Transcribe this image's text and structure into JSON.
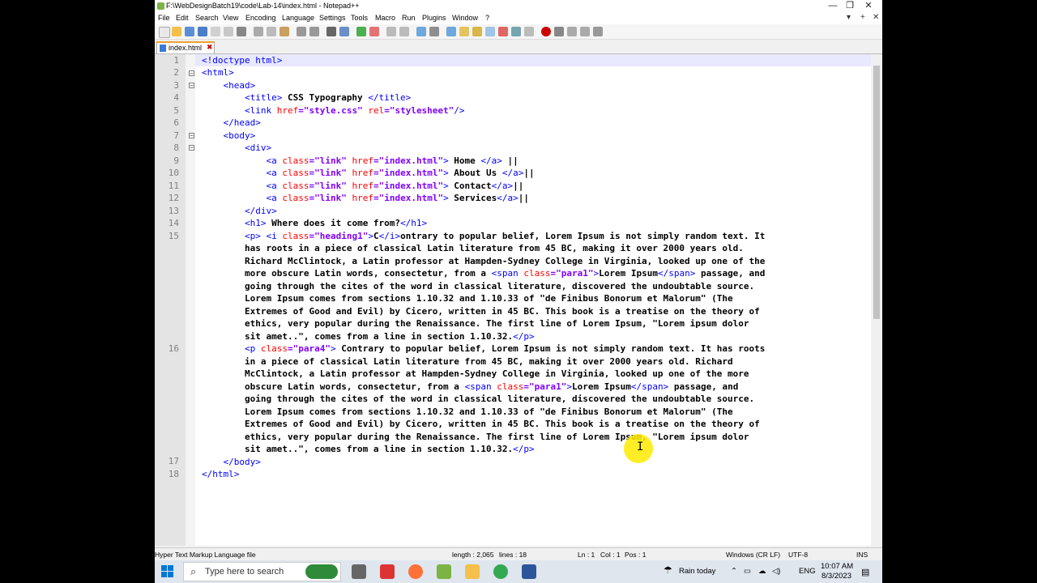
{
  "window": {
    "title": "F:\\WebDesignBatch19\\code\\Lab-14\\index.html - Notepad++",
    "min_icon": "minimize-icon",
    "max_icon": "restore-icon",
    "close_icon": "close-icon",
    "min_glyph": "—",
    "max_glyph": "❐",
    "close_glyph": "✕"
  },
  "menu": {
    "items": [
      "File",
      "Edit",
      "Search",
      "View",
      "Encoding",
      "Language",
      "Settings",
      "Tools",
      "Macro",
      "Run",
      "Plugins",
      "Window",
      "?"
    ],
    "right_glyphs": [
      "▾",
      "+",
      "✕"
    ]
  },
  "tab": {
    "label": "index.html",
    "close_glyph": "✖"
  },
  "editor": {
    "line_numbers": [
      "1",
      "2",
      "3",
      "4",
      "5",
      "6",
      "7",
      "8",
      "9",
      "10",
      "11",
      "12",
      "13",
      "14",
      "15",
      "16",
      "17",
      "18"
    ]
  },
  "code": {
    "l1": "<!doctype html>",
    "l2": "<html>",
    "l3": "<head>",
    "l4a": "<title>",
    "l4b": " CSS Typography ",
    "l4c": "</title>",
    "l5a": "<link ",
    "l5b": "href",
    "l5c": "=\"style.css\" ",
    "l5d": "rel",
    "l5e": "=\"stylesheet\"",
    "l5f": "/>",
    "l6": "</head>",
    "l7": "<body>",
    "l8": "<div>",
    "l9a": "<a ",
    "l9b": "class",
    "l9c": "=\"link\" ",
    "l9d": "href",
    "l9e": "=\"index.html\"",
    "l9f": ">",
    "l9g": " Home ",
    "l9h": "</a>",
    "l9i": " ||",
    "l10g": " About Us ",
    "l10h": "</a>",
    "l10i": "||",
    "l11g": " Contact",
    "l11h": "</a>",
    "l11i": "||",
    "l12g": " Services",
    "l12h": "</a>",
    "l12i": "||",
    "l13": "</div>",
    "l14a": "<h1>",
    "l14b": " Where does it come from?",
    "l14c": "</h1>",
    "l15_1a": "<p> <i ",
    "l15_1b": "class",
    "l15_1c": "=\"heading1\"",
    "l15_1d": ">",
    "l15_1e": "C",
    "l15_1f": "</i>",
    "l15_1g": "ontrary to popular belief, Lorem Ipsum is not simply random text. It",
    "l15_2": "has roots in a piece of classical Latin literature from 45 BC, making it over 2000 years old.",
    "l15_3": "Richard McClintock, a Latin professor at Hampden-Sydney College in Virginia, looked up one of the",
    "l15_4a": "more obscure Latin words, consectetur, from a ",
    "l15_4b": "<span ",
    "l15_4c": "class",
    "l15_4d": "=\"para1\"",
    "l15_4e": ">",
    "l15_4f": "Lorem Ipsum",
    "l15_4g": "</span>",
    "l15_4h": " passage, and",
    "l15_5": "going through the cites of the word in classical literature, discovered the undoubtable source.",
    "l15_6": "Lorem Ipsum comes from sections 1.10.32 and 1.10.33 of \"de Finibus Bonorum et Malorum\" (The",
    "l15_7": "Extremes of Good and Evil) by Cicero, written in 45 BC. This book is a treatise on the theory of",
    "l15_8": "ethics, very popular during the Renaissance. The first line of Lorem Ipsum, \"Lorem ipsum dolor",
    "l15_9a": "sit amet..\", comes from a line in section 1.10.32.",
    "l15_9b": "</p>",
    "l16_1a": "<p ",
    "l16_1b": "class",
    "l16_1c": "=\"para4\"",
    "l16_1d": ">",
    "l16_1e": " Contrary to popular belief, Lorem Ipsum is not simply random text. It has roots",
    "l16_2": "in a piece of classical Latin literature from 45 BC, making it over 2000 years old. Richard",
    "l16_3": "McClintock, a Latin professor at Hampden-Sydney College in Virginia, looked up one of the more",
    "l16_4a": "obscure Latin words, consectetur, from a ",
    "l16_4h": " passage, and",
    "l16_5": "going through the cites of the word in classical literature, discovered the undoubtable source.",
    "l16_6": "Lorem Ipsum comes from sections 1.10.32 and 1.10.33 of \"de Finibus Bonorum et Malorum\" (The",
    "l16_7": "Extremes of Good and Evil) by Cicero, written in 45 BC. This book is a treatise on the theory of",
    "l16_8": "ethics, very popular during the Renaissance. The first line of Lorem Ipsum, \"Lorem ipsum dolor",
    "l16_9a": "sit amet..\", comes from a line in section 1.10.32.",
    "l16_9b": "</p>",
    "l17": "</body>",
    "l18": "</html>"
  },
  "status": {
    "file_type": "Hyper Text Markup Language file",
    "length": "length : 2,065",
    "lines": "lines : 18",
    "ln": "Ln : 1",
    "col": "Col : 1",
    "pos": "Pos : 1",
    "eol": "Windows (CR LF)",
    "encoding": "UTF-8",
    "mode": "INS"
  },
  "taskbar": {
    "search_placeholder": "Type here to search",
    "weather": "Rain today",
    "language": "ENG",
    "time": "10:07 AM",
    "date": "8/3/2023"
  },
  "colors": {
    "tag": "#0000ff",
    "attr": "#ff0000",
    "value": "#8000ff",
    "highlight": "#ffeb00"
  }
}
